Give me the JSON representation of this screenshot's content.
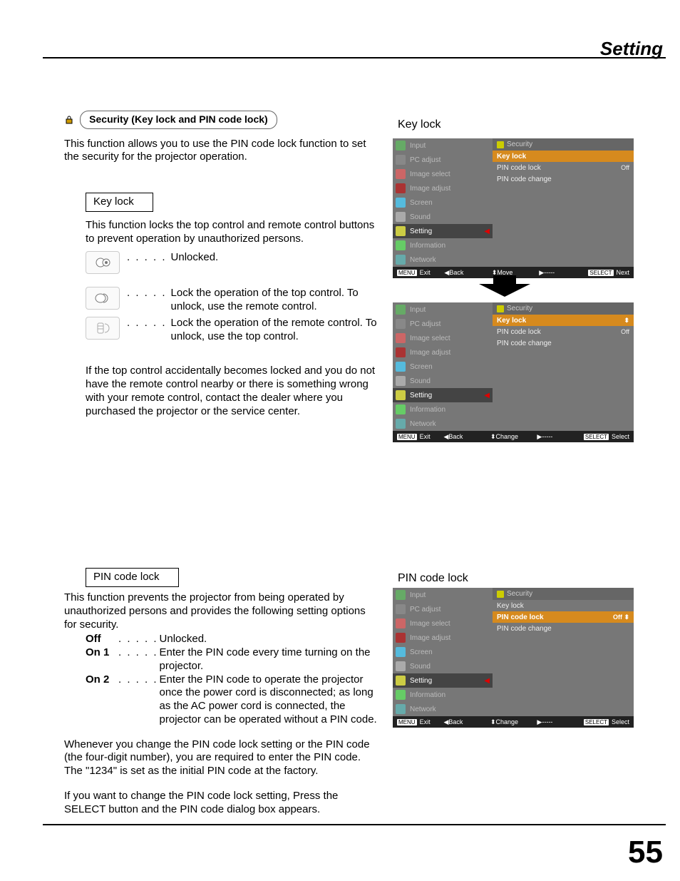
{
  "header": {
    "title": "Setting",
    "page_number": "55"
  },
  "security": {
    "badge": "Security (Key lock and PIN code lock)",
    "intro": "This function allows you to use the PIN code lock function to set the security for the projector operation."
  },
  "keylock": {
    "title": "Key lock",
    "intro": "This function locks the top control and remote control buttons to prevent operation by unauthorized persons.",
    "items": [
      {
        "dots": ". . . . .",
        "text": "Unlocked."
      },
      {
        "dots": ". . . . .",
        "text": "Lock the operation of the top control. To unlock, use the remote control."
      },
      {
        "dots": ". . . . .",
        "text": "Lock the operation of the remote control. To unlock, use the top control."
      }
    ],
    "warning": "If the top control accidentally becomes locked and you do not have the remote control nearby or there is something wrong with your remote control, contact the dealer where you purchased the projector or the service center."
  },
  "pinlock": {
    "title": "PIN code lock",
    "intro": "This function prevents the projector from being operated by unauthorized persons and provides the following setting options for security.",
    "options": [
      {
        "k": "Off",
        "dots": ". . . . .",
        "v": "Unlocked."
      },
      {
        "k": "On 1",
        "dots": ". . . . .",
        "v": "Enter the PIN code every time turning on the projector."
      },
      {
        "k": "On 2",
        "dots": ". . . . .",
        "v": "Enter the PIN code to operate the projector once the power cord is disconnected; as long as the AC power cord is connected, the projector can be operated without a PIN code."
      }
    ],
    "note1": "Whenever you change the PIN code lock setting or the PIN code (the four-digit number), you are required to enter the PIN code. The \"1234\" is set as the initial PIN code at the factory.",
    "note2": "If you want to change the PIN code lock setting, Press the SELECT button and the PIN code dialog box appears."
  },
  "right": {
    "label1": "Key lock",
    "label2": "PIN code lock"
  },
  "osd": {
    "sidebar": [
      "Input",
      "PC adjust",
      "Image select",
      "Image adjust",
      "Screen",
      "Sound",
      "Setting",
      "Information",
      "Network"
    ],
    "panel_title": "Security",
    "rows": {
      "keylock": "Key lock",
      "pin_lock": "PIN code lock",
      "pin_change": "PIN code change",
      "off": "Off"
    },
    "status": {
      "menu": "MENU",
      "exit": "Exit",
      "back": "Back",
      "move": "Move",
      "change": "Change",
      "dashes": "-----",
      "select": "SELECT",
      "next": "Next",
      "select2": "Select"
    }
  }
}
